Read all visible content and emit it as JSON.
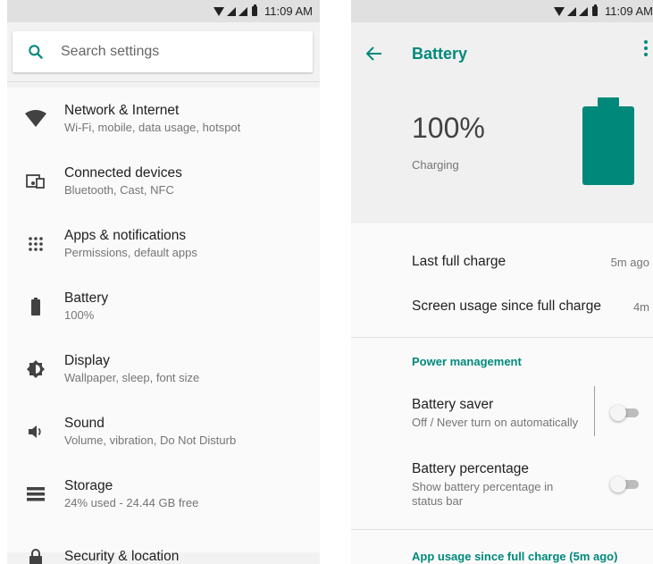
{
  "left": {
    "status": {
      "time": "11:09 AM"
    },
    "search": {
      "placeholder": "Search settings"
    },
    "items": [
      {
        "title": "Network & Internet",
        "subtitle": "Wi-Fi, mobile, data usage, hotspot",
        "icon": "wifi-icon"
      },
      {
        "title": "Connected devices",
        "subtitle": "Bluetooth, Cast, NFC",
        "icon": "devices-icon"
      },
      {
        "title": "Apps & notifications",
        "subtitle": "Permissions, default apps",
        "icon": "apps-icon"
      },
      {
        "title": "Battery",
        "subtitle": "100%",
        "icon": "battery-icon"
      },
      {
        "title": "Display",
        "subtitle": "Wallpaper, sleep, font size",
        "icon": "brightness-icon"
      },
      {
        "title": "Sound",
        "subtitle": "Volume, vibration, Do Not Disturb",
        "icon": "volume-icon"
      },
      {
        "title": "Storage",
        "subtitle": "24% used - 24.44 GB free",
        "icon": "storage-icon"
      },
      {
        "title": "Security & location",
        "subtitle": "",
        "icon": "lock-icon"
      }
    ]
  },
  "right": {
    "status": {
      "time": "11:09 AM"
    },
    "appbar": {
      "title": "Battery"
    },
    "hero": {
      "percent": "100%",
      "status": "Charging",
      "level": 1.0
    },
    "rows": [
      {
        "label": "Last full charge",
        "value": "5m ago"
      },
      {
        "label": "Screen usage since full charge",
        "value": "4m"
      }
    ],
    "power_management": "Power management",
    "battery_saver": {
      "title": "Battery saver",
      "subtitle": "Off / Never turn on automatically",
      "on": false
    },
    "battery_percentage": {
      "title": "Battery percentage",
      "subtitle": "Show battery percentage in status bar",
      "on": false
    },
    "app_usage": "App usage since full charge (5m ago)"
  },
  "colors": {
    "accent": "#00897b",
    "status_bar": "#e0e0e0",
    "toggle_off": "#bdbdbd"
  }
}
